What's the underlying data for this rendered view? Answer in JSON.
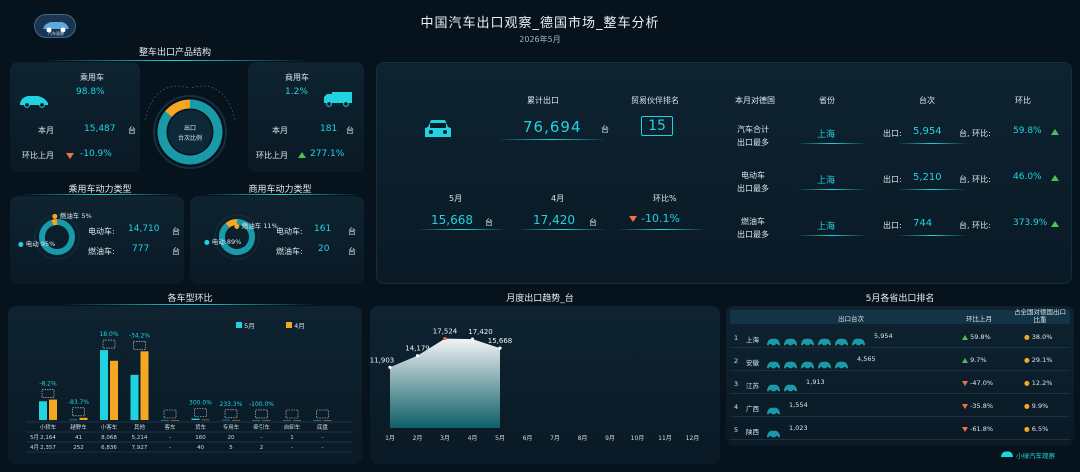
{
  "header": {
    "title": "中国汽车出口观察_德国市场_整车分析",
    "date": "2026年5月",
    "logo_text": "汽车观察"
  },
  "structure": {
    "title": "整车出口产品结构",
    "passenger": {
      "label": "乘用车",
      "share": "98.8%",
      "month_label": "本月",
      "month_value": "15,487",
      "unit": "台",
      "mom_label": "环比上月",
      "mom_value": "-10.9%"
    },
    "commercial": {
      "label": "商用车",
      "share": "1.2%",
      "month_label": "本月",
      "month_value": "181",
      "unit": "台",
      "mom_label": "环比上月",
      "mom_value": "277.1%"
    },
    "donut_label_1": "出口",
    "donut_label_2": "台次比例",
    "donut_share_passenger": 98.8
  },
  "passenger_power": {
    "title": "乘用车动力类型",
    "legend_fuel": "燃油车 5%",
    "legend_ev": "电动 95%",
    "ev_label": "电动车:",
    "ev_value": "14,710",
    "fuel_label": "燃油车:",
    "fuel_value": "777",
    "unit": "台",
    "ev_share": 95
  },
  "commercial_power": {
    "title": "商用车动力类型",
    "legend_fuel": "燃油车 11%",
    "legend_ev": "电动 89%",
    "ev_label": "电动车:",
    "ev_value": "161",
    "fuel_label": "燃油车:",
    "fuel_value": "20",
    "unit": "台",
    "ev_share": 89
  },
  "summary": {
    "cum_label": "累计出口",
    "cum_value": "76,694",
    "unit": "台",
    "rank_label": "贸易伙伴排名",
    "rank_value": "15",
    "may_label": "5月",
    "may_value": "15,668",
    "apr_label": "4月",
    "apr_value": "17,420",
    "mom_label": "环比%",
    "mom_value": "-10.1%"
  },
  "province_top": {
    "col_header": "本月对德国",
    "col_province": "省份",
    "col_count": "台次",
    "col_mom": "环比",
    "rows": [
      {
        "label1": "汽车合计",
        "label2": "出口最多",
        "province": "上海",
        "export_label": "出口:",
        "value": "5,954",
        "unit_mom": "台, 环比:",
        "mom": "59.8%"
      },
      {
        "label1": "电动车",
        "label2": "出口最多",
        "province": "上海",
        "export_label": "出口:",
        "value": "5,210",
        "unit_mom": "台, 环比:",
        "mom": "46.0%"
      },
      {
        "label1": "燃油车",
        "label2": "出口最多",
        "province": "上海",
        "export_label": "出口:",
        "value": "744",
        "unit_mom": "台, 环比:",
        "mom": "373.9%"
      }
    ]
  },
  "type_mom": {
    "title": "各车型环比",
    "legend_may": "5月",
    "legend_apr": "4月",
    "row_may": "5月",
    "row_apr": "4月",
    "colors": {
      "may": "#1fd4e0",
      "apr": "#f5a623"
    },
    "categories": [
      {
        "name": "小轿车",
        "may": "2,164",
        "apr": "2,357",
        "pct": "-8.2%"
      },
      {
        "name": "越野车",
        "may": "41",
        "apr": "252",
        "pct": "-83.7%"
      },
      {
        "name": "小客车",
        "may": "8,068",
        "apr": "6,836",
        "pct": "18.0%"
      },
      {
        "name": "其他",
        "may": "5,214",
        "apr": "7,927",
        "pct": "-34.2%"
      },
      {
        "name": "客车",
        "may": "-",
        "apr": "-",
        "pct": ""
      },
      {
        "name": "货车",
        "may": "160",
        "apr": "40",
        "pct": "300.0%"
      },
      {
        "name": "专用车",
        "may": "20",
        "apr": "5",
        "pct": "233.3%"
      },
      {
        "name": "牵引车",
        "may": "-",
        "apr": "2",
        "pct": "-100.0%"
      },
      {
        "name": "自卸车",
        "may": "1",
        "apr": "-",
        "pct": ""
      },
      {
        "name": "底盘",
        "may": "-",
        "apr": "-",
        "pct": ""
      }
    ]
  },
  "chart_data": {
    "type": "area",
    "title": "月度出口趋势_台",
    "categories": [
      "1月",
      "2月",
      "3月",
      "4月",
      "5月",
      "6月",
      "7月",
      "8月",
      "9月",
      "10月",
      "11月",
      "12月"
    ],
    "series": [
      {
        "values": [
          11903,
          14179,
          17524,
          17420,
          15668
        ]
      }
    ],
    "labels": [
      "11,903",
      "14,179",
      "17,524",
      "17,420",
      "15,668"
    ],
    "ylim": [
      0,
      20000
    ]
  },
  "province_rank": {
    "title": "5月各省出口排名",
    "col_count": "出口台次",
    "col_mom": "环比上月",
    "col_share": "占全国对德国出口比重",
    "rows": [
      {
        "rank": "1",
        "name": "上海",
        "value": "5,954",
        "cars": 6,
        "mom": "59.8%",
        "dir": "up",
        "share": "38.0%"
      },
      {
        "rank": "2",
        "name": "安徽",
        "value": "4,565",
        "cars": 5,
        "mom": "9.7%",
        "dir": "up",
        "share": "29.1%"
      },
      {
        "rank": "3",
        "name": "江苏",
        "value": "1,913",
        "cars": 2,
        "mom": "-47.0%",
        "dir": "down",
        "share": "12.2%"
      },
      {
        "rank": "4",
        "name": "广西",
        "value": "1,554",
        "cars": 1,
        "mom": "-35.8%",
        "dir": "down",
        "share": "9.9%"
      },
      {
        "rank": "5",
        "name": "陕西",
        "value": "1,023",
        "cars": 1,
        "mom": "-61.8%",
        "dir": "down",
        "share": "6.5%"
      }
    ]
  },
  "footer": {
    "brand": "小绿汽车观察"
  }
}
